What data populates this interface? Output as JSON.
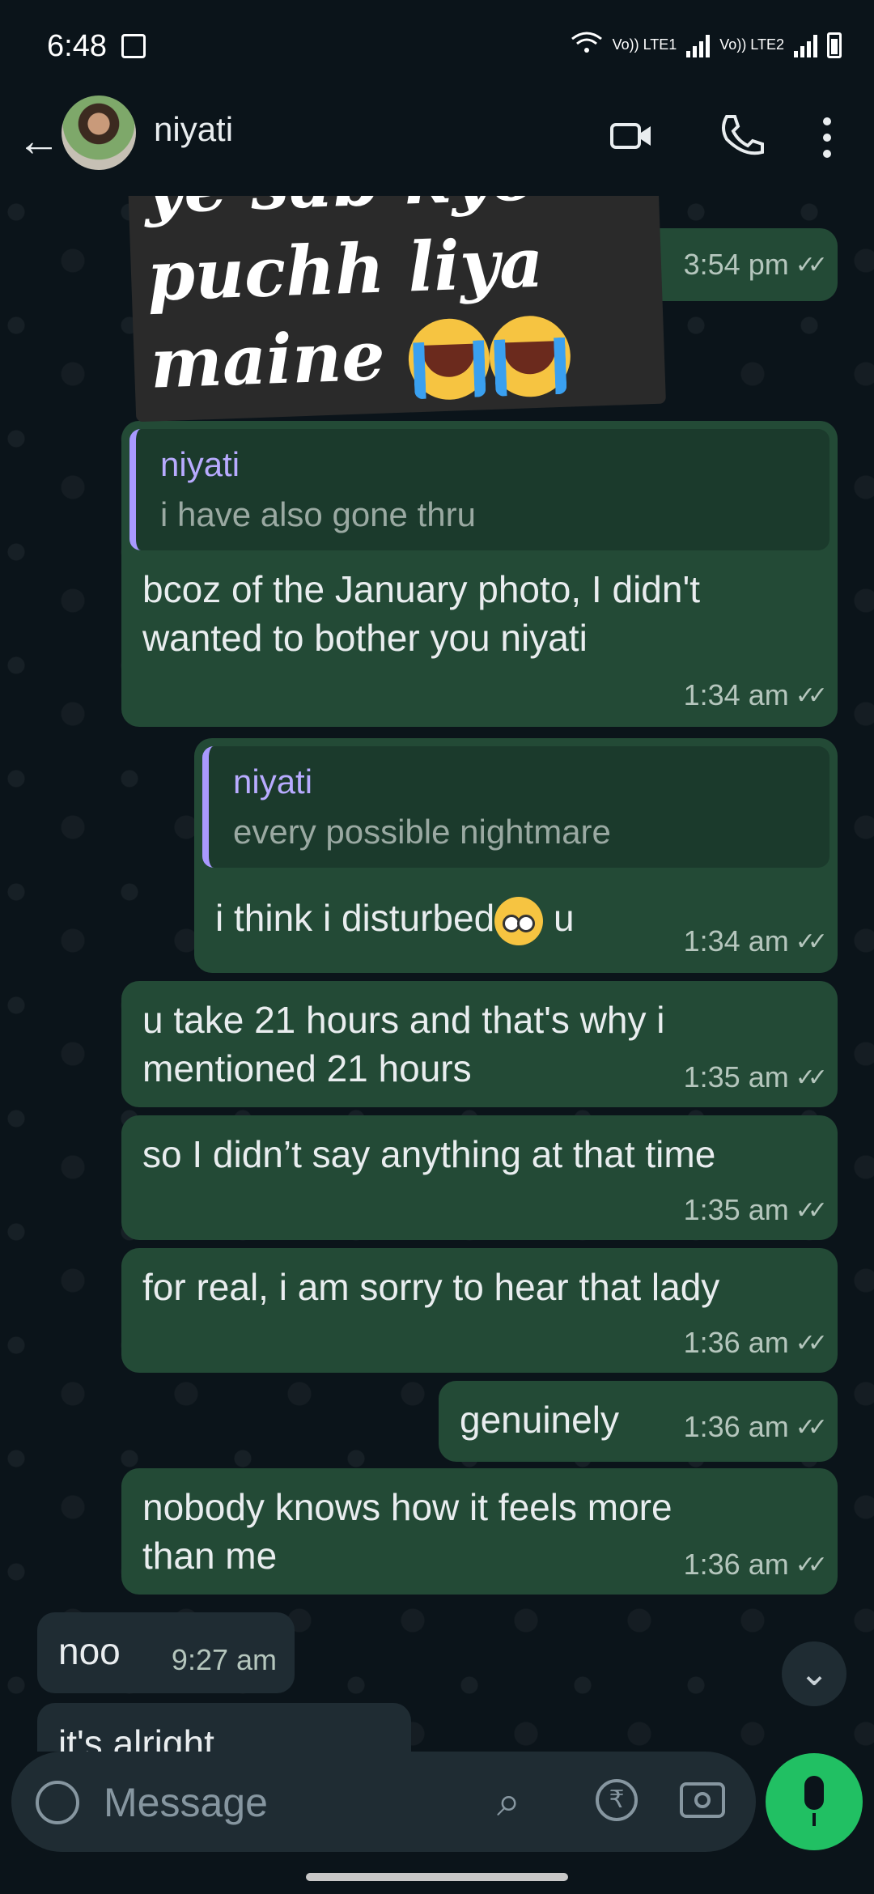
{
  "status_bar": {
    "time": "6:48",
    "sim1": "Vo)) LTE1",
    "sim2": "Vo)) LTE2"
  },
  "header": {
    "contact_name": "niyati"
  },
  "sticker_overlay": {
    "line1": "ye sab kyo",
    "line2": "puchh liya",
    "line3": "maine"
  },
  "messages": [
    {
      "text": "",
      "time": "3:54 pm"
    },
    {
      "quote_name": "niyati",
      "quote_text": "i have also gone thru",
      "line1": "bcoz of the January photo, I didn't",
      "line2": "wanted to bother you niyati",
      "time": "1:34 am"
    },
    {
      "quote_name": "niyati",
      "quote_text": "every possible nightmare",
      "text_a": "i think i disturbed",
      "text_b": " u",
      "time": "1:34 am"
    },
    {
      "line1": "u take 21 hours and that's why i",
      "line2": "mentioned 21 hours",
      "time": "1:35 am"
    },
    {
      "text": "so I didn’t say anything at that time",
      "time": "1:35 am"
    },
    {
      "text": "for real, i am sorry to hear that lady",
      "time": "1:36 am"
    },
    {
      "text": "genuinely",
      "time": "1:36 am"
    },
    {
      "line1": "nobody knows how it feels more",
      "line2": "than me",
      "time": "1:36 am"
    },
    {
      "text": "noo",
      "time": "9:27 am"
    },
    {
      "text": "it's alright"
    }
  ],
  "composer": {
    "placeholder": "Message"
  },
  "colors": {
    "outgoing_bubble": "#234a36",
    "incoming_bubble": "#1f2c33",
    "accent_green": "#21c063",
    "quote_bar": "#a999ff"
  },
  "icons": [
    "back-arrow-icon",
    "video-call-icon",
    "phone-icon",
    "more-vert-icon",
    "read-ticks-icon",
    "scroll-down-icon",
    "emoji-sticker-icon",
    "attach-icon",
    "rupee-icon",
    "camera-icon",
    "mic-icon"
  ]
}
